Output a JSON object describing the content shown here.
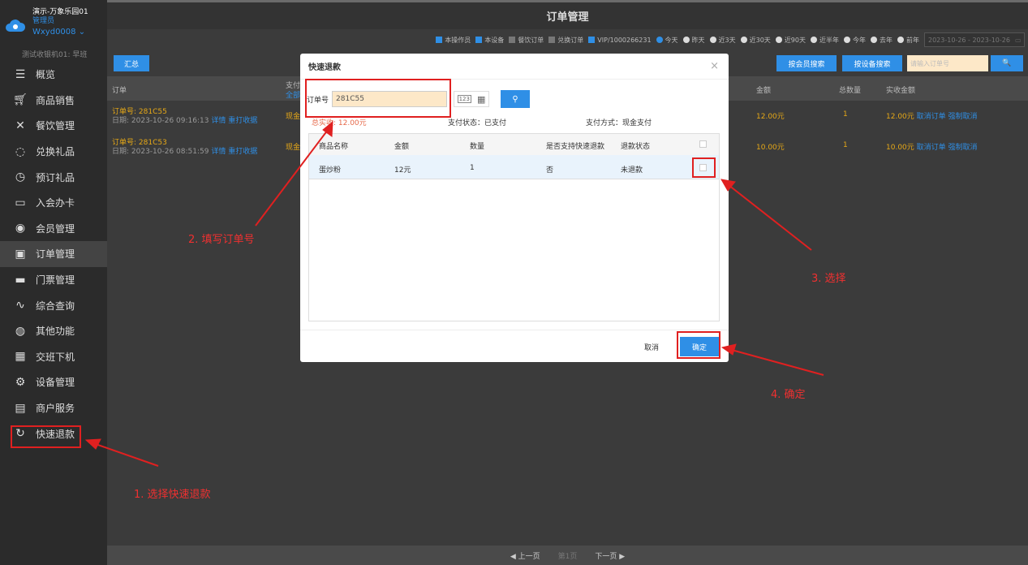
{
  "sidebar": {
    "brand_line1": "演示-万象乐园01",
    "brand_line2": "管理员",
    "brand_line3": "Wxyd0008 ⌄",
    "brand_line4": "测试收银机01: 早班",
    "items": [
      {
        "label": "概览",
        "icon": "menu-icon"
      },
      {
        "label": "商品销售",
        "icon": "cart-icon"
      },
      {
        "label": "餐饮管理",
        "icon": "utensils-icon"
      },
      {
        "label": "兑换礼品",
        "icon": "gift-icon"
      },
      {
        "label": "预订礼品",
        "icon": "clock-icon"
      },
      {
        "label": "入会办卡",
        "icon": "card-icon"
      },
      {
        "label": "会员管理",
        "icon": "user-icon"
      },
      {
        "label": "订单管理",
        "icon": "clipboard-icon"
      },
      {
        "label": "门票管理",
        "icon": "ticket-icon"
      },
      {
        "label": "综合查询",
        "icon": "pulse-icon"
      },
      {
        "label": "其他功能",
        "icon": "globe-icon"
      },
      {
        "label": "交班下机",
        "icon": "calculator-icon"
      },
      {
        "label": "设备管理",
        "icon": "gear-icon"
      },
      {
        "label": "商户服务",
        "icon": "document-icon"
      },
      {
        "label": "快速退款",
        "icon": "refresh-icon"
      }
    ]
  },
  "header": {
    "title": "订单管理"
  },
  "filters": {
    "checks": [
      {
        "label": "本操作员",
        "on": true
      },
      {
        "label": "本设备",
        "on": true
      },
      {
        "label": "餐饮订单",
        "on": false
      },
      {
        "label": "兑换订单",
        "on": false
      },
      {
        "label": "VIP/1000266231",
        "on": true
      }
    ],
    "radios": [
      {
        "label": "今天",
        "on": true
      },
      {
        "label": "昨天",
        "on": false
      },
      {
        "label": "近3天",
        "on": false
      },
      {
        "label": "近30天",
        "on": false
      },
      {
        "label": "近90天",
        "on": false
      },
      {
        "label": "近半年",
        "on": false
      },
      {
        "label": "今年",
        "on": false
      },
      {
        "label": "去年",
        "on": false
      },
      {
        "label": "前年",
        "on": false
      }
    ],
    "date_range": "2023-10-26 - 2023-10-26"
  },
  "actions": {
    "summary": "汇总",
    "member_search": "按会员搜索",
    "device_search": "按设备搜索",
    "order_placeholder": "请输入订单号",
    "search_icon": "🔍"
  },
  "table": {
    "headers": {
      "order": "订单",
      "pay": "支付",
      "pay_sub": "全部",
      "amount": "金额",
      "qty": "总数量",
      "real": "实收金额"
    },
    "rows": [
      {
        "order_no": "订单号: 281C55",
        "date": "日期: 2023-10-26 09:16:13",
        "detail": "详情",
        "reprint": "重打收据",
        "pay": "现金",
        "amount": "12.00元",
        "qty": "1",
        "real": "12.00元",
        "cancel": "取消订单",
        "force": "强制取消"
      },
      {
        "order_no": "订单号: 281C53",
        "date": "日期: 2023-10-26 08:51:59",
        "detail": "详情",
        "reprint": "重打收据",
        "pay": "现金",
        "amount": "10.00元",
        "qty": "1",
        "real": "10.00元",
        "cancel": "取消订单",
        "force": "强制取消"
      }
    ]
  },
  "pager": {
    "prev": "◀ 上一页",
    "current": "第1页",
    "next": "下一页 ▶"
  },
  "modal": {
    "title": "快速退款",
    "close": "×",
    "order_label": "订单号",
    "order_value": "281C55",
    "kbd_num": "123",
    "kbd_icon": "▦",
    "total_label": "总实收: 12.00元",
    "pay_status": "支付状态：已支付",
    "pay_method": "支付方式：现金支付",
    "headers": {
      "name": "商品名称",
      "amount": "金额",
      "qty": "数量",
      "support": "是否支持快速退款",
      "status": "退款状态"
    },
    "items": [
      {
        "name": "蛋炒粉",
        "amount": "12元",
        "qty": "1",
        "support": "否",
        "status": "未退款"
      }
    ],
    "cancel": "取消",
    "confirm": "确定"
  },
  "annotations": {
    "step1": "1. 选择快速退款",
    "step2": "2. 填写订单号",
    "step3": "3. 选择",
    "step4": "4. 确定"
  },
  "colors": {
    "accent": "#2f8fe6",
    "annotation": "#e02020",
    "order_text": "#e6a817"
  }
}
